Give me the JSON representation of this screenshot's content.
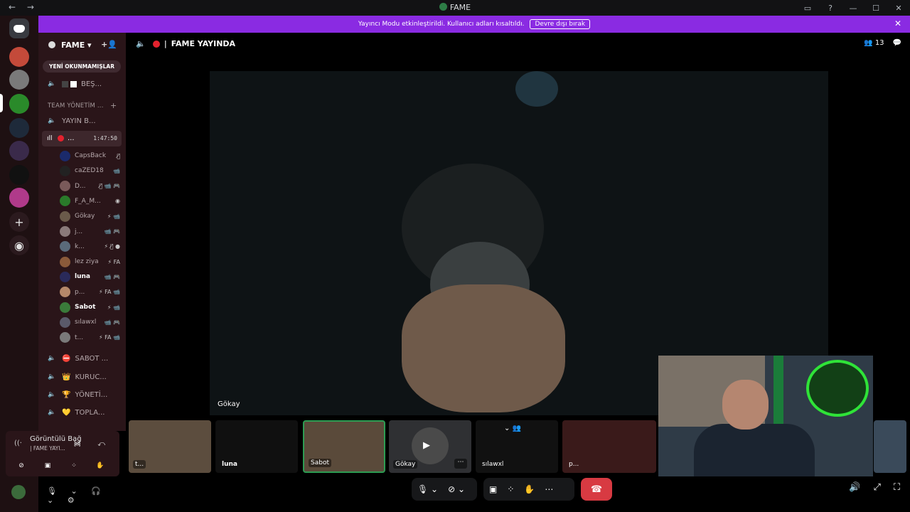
{
  "window": {
    "title": "FAME",
    "nav": "← →",
    "controls": [
      "▭",
      "?",
      "—",
      "☐",
      "✕"
    ]
  },
  "banner": {
    "text": "Yayıncı Modu etkinleştirildi. Kullanıcı adları kısaltıldı.",
    "button": "Devre dışı bırak",
    "close": "✕"
  },
  "server": {
    "name": "FAME ▾",
    "invite_icon": "add-user-icon"
  },
  "unread_button": "YENİ OKUNMAMIŞLAR",
  "channels": {
    "top": {
      "label": "BEŞ...",
      "icon": "speaker-icon"
    },
    "category": "TEAM YÖNETİM ...",
    "category_plus": "+",
    "yayin": {
      "label": "YAYIN B...",
      "icon": "speaker-icon"
    },
    "active": {
      "label": "...",
      "time": "1:47:50"
    },
    "more": [
      {
        "label": "SABOT ...",
        "emoji": "⛔"
      },
      {
        "label": "KURUC...",
        "emoji": "👑"
      },
      {
        "label": "YÖNETİ...",
        "emoji": "🏆"
      },
      {
        "label": "TOPLA...",
        "emoji": "💛"
      }
    ]
  },
  "members": [
    {
      "name": "CapsBack",
      "status": "🎙̸",
      "color": "#1b2a6b"
    },
    {
      "name": "caZED18",
      "status": "📹",
      "color": "#222"
    },
    {
      "name": "D...",
      "status": "🎙̸ 📹 🎮",
      "color": "#7a5a5a"
    },
    {
      "name": "F_A_M...",
      "status": "◉",
      "color": "#2a7a2a"
    },
    {
      "name": "Gökay",
      "status": "⚡ 📹",
      "color": "#6a5a4a"
    },
    {
      "name": "j...",
      "status": "📹 🎮",
      "color": "#8a7a7a"
    },
    {
      "name": "k...",
      "status": "⚡ 🎙̸ ●",
      "color": "#5a6a7a"
    },
    {
      "name": "lez ziya",
      "status": "⚡ FA",
      "color": "#8a5a3a"
    },
    {
      "name": "luna",
      "status": "📹 🎮",
      "color": "#2a2a5a"
    },
    {
      "name": "p...",
      "status": "⚡ FA 📹",
      "color": "#b5886a"
    },
    {
      "name": "Sabot",
      "status": "⚡ 📹",
      "color": "#3a7a3a"
    },
    {
      "name": "sılawxl",
      "status": "📹 🎮",
      "color": "#5a5a6a"
    },
    {
      "name": "t...",
      "status": "⚡ FA 📹",
      "color": "#7a7a7a"
    }
  ],
  "voice": {
    "title": "Görüntülü Bağ",
    "sub": "| FAME YAYI...",
    "right": "᯼ ⤺"
  },
  "voice_buttons": [
    "⊘",
    "▣",
    "⁘",
    "✋"
  ],
  "user_controls": "🎙 ⌄ 🎧 ⌄ ⚙",
  "main_header": {
    "title": "FAME YAYINDA",
    "divider": "|",
    "count": "13"
  },
  "stage": {
    "name": "Gökay"
  },
  "tiles": [
    {
      "name": "t...",
      "bg": "#5c4d3e"
    },
    {
      "name": "luna",
      "bg": "#101010"
    },
    {
      "name": "Sabot",
      "bg": "#5a4a3a"
    },
    {
      "name": "Gökay",
      "bg": "#2f3033"
    },
    {
      "name": "sılawxl",
      "bg": "#111"
    },
    {
      "name": "p...",
      "bg": "#3a1a1a"
    }
  ],
  "controls": {
    "mic": "🎙 ⌄",
    "cam": "⊘ ⌄",
    "share": "▣",
    "apps": "⁘",
    "raise": "✋",
    "more": "⋯",
    "hang": "☎",
    "right": [
      "🔊",
      "⤢",
      "⛶"
    ]
  }
}
